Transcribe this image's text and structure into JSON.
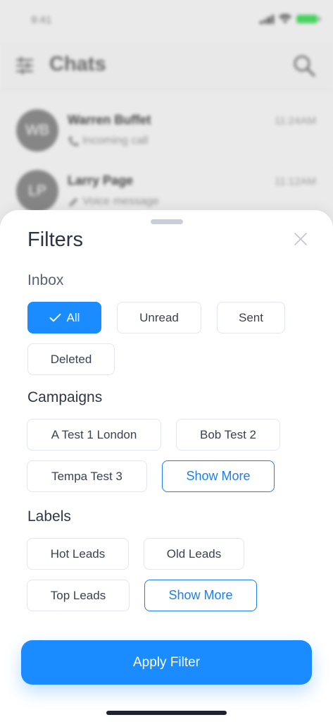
{
  "status_bar": {
    "time": "9:41"
  },
  "chats_header": {
    "title": "Chats",
    "filter_icon": "sliders-icon",
    "search_icon": "search-icon"
  },
  "chats": [
    {
      "initials": "WB",
      "name": "Warren Buffet",
      "subtitle": "Incoming call",
      "subtitle_icon": "phone-icon",
      "time": "11:24AM"
    },
    {
      "initials": "LP",
      "name": "Larry Page",
      "subtitle": "Voice message",
      "subtitle_icon": "pencil-icon",
      "time": "11:12AM"
    }
  ],
  "filters": {
    "title": "Filters",
    "close_icon": "close-icon",
    "inbox": {
      "title": "Inbox",
      "options": [
        {
          "label": "All",
          "selected": true
        },
        {
          "label": "Unread",
          "selected": false
        },
        {
          "label": "Sent",
          "selected": false
        },
        {
          "label": "Deleted",
          "selected": false
        }
      ]
    },
    "campaigns": {
      "title": "Campaigns",
      "options": [
        "A Test 1 London",
        "Bob Test 2",
        "Tempa Test 3"
      ],
      "show_more": "Show More"
    },
    "labels": {
      "title": "Labels",
      "options": [
        "Hot Leads",
        "Old Leads",
        "Top Leads"
      ],
      "show_more": "Show More"
    },
    "apply_label": "Apply Filter"
  },
  "colors": {
    "accent": "#1a8cff",
    "chip_border": "#e3e6ec",
    "title_text": "#2b3445"
  }
}
